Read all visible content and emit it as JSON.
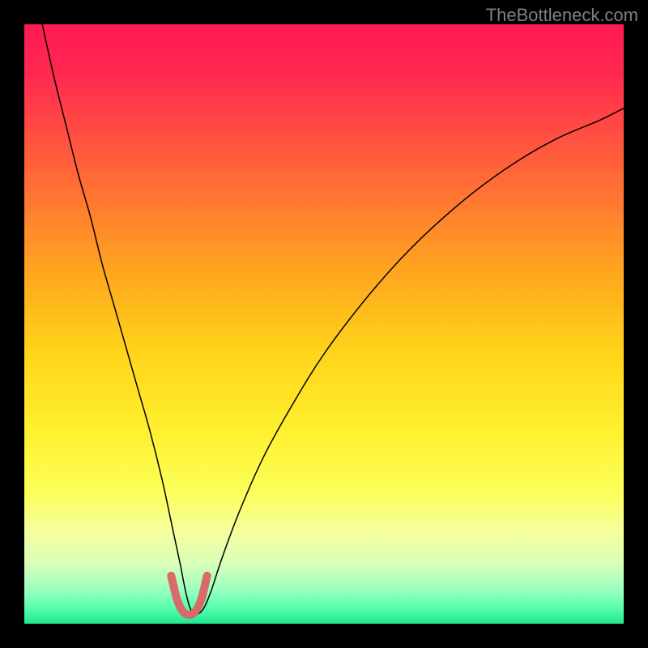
{
  "watermark": "TheBottleneck.com",
  "chart_data": {
    "type": "line",
    "title": "",
    "xlabel": "",
    "ylabel": "",
    "xlim": [
      0,
      100
    ],
    "ylim": [
      0,
      100
    ],
    "background_gradient": {
      "stops": [
        {
          "offset": 0.0,
          "color": "#ff1a54"
        },
        {
          "offset": 0.08,
          "color": "#ff2850"
        },
        {
          "offset": 0.18,
          "color": "#ff4d42"
        },
        {
          "offset": 0.3,
          "color": "#ff7a30"
        },
        {
          "offset": 0.42,
          "color": "#ffa81e"
        },
        {
          "offset": 0.55,
          "color": "#ffd51a"
        },
        {
          "offset": 0.68,
          "color": "#fff030"
        },
        {
          "offset": 0.78,
          "color": "#fcff5a"
        },
        {
          "offset": 0.85,
          "color": "#f5ffa0"
        },
        {
          "offset": 0.9,
          "color": "#d8ffb8"
        },
        {
          "offset": 0.94,
          "color": "#a0ffc0"
        },
        {
          "offset": 0.97,
          "color": "#60ffb0"
        },
        {
          "offset": 1.0,
          "color": "#20e890"
        }
      ]
    },
    "series": [
      {
        "name": "bottleneck-curve",
        "stroke": "#000000",
        "stroke_width": 1.5,
        "x": [
          3,
          5,
          7,
          9,
          11,
          13,
          15,
          17,
          19,
          21,
          23,
          24.5,
          26,
          27,
          28,
          29.5,
          31,
          33,
          36,
          40,
          45,
          50,
          56,
          62,
          68,
          75,
          82,
          89,
          96,
          100
        ],
        "y": [
          100,
          91,
          83,
          75,
          68,
          60,
          53,
          46,
          39,
          32,
          24,
          17,
          10,
          5,
          2,
          2,
          5,
          11,
          19,
          28,
          37,
          45,
          53,
          60,
          66,
          72,
          77,
          81,
          84,
          86
        ]
      },
      {
        "name": "bottom-highlight",
        "stroke": "#d86a6a",
        "stroke_width": 10,
        "linecap": "round",
        "x": [
          24.5,
          25.5,
          26.5,
          27.5,
          28.5,
          29.5,
          30.5
        ],
        "y": [
          8,
          4,
          2,
          1.5,
          2,
          4,
          8
        ]
      }
    ]
  }
}
